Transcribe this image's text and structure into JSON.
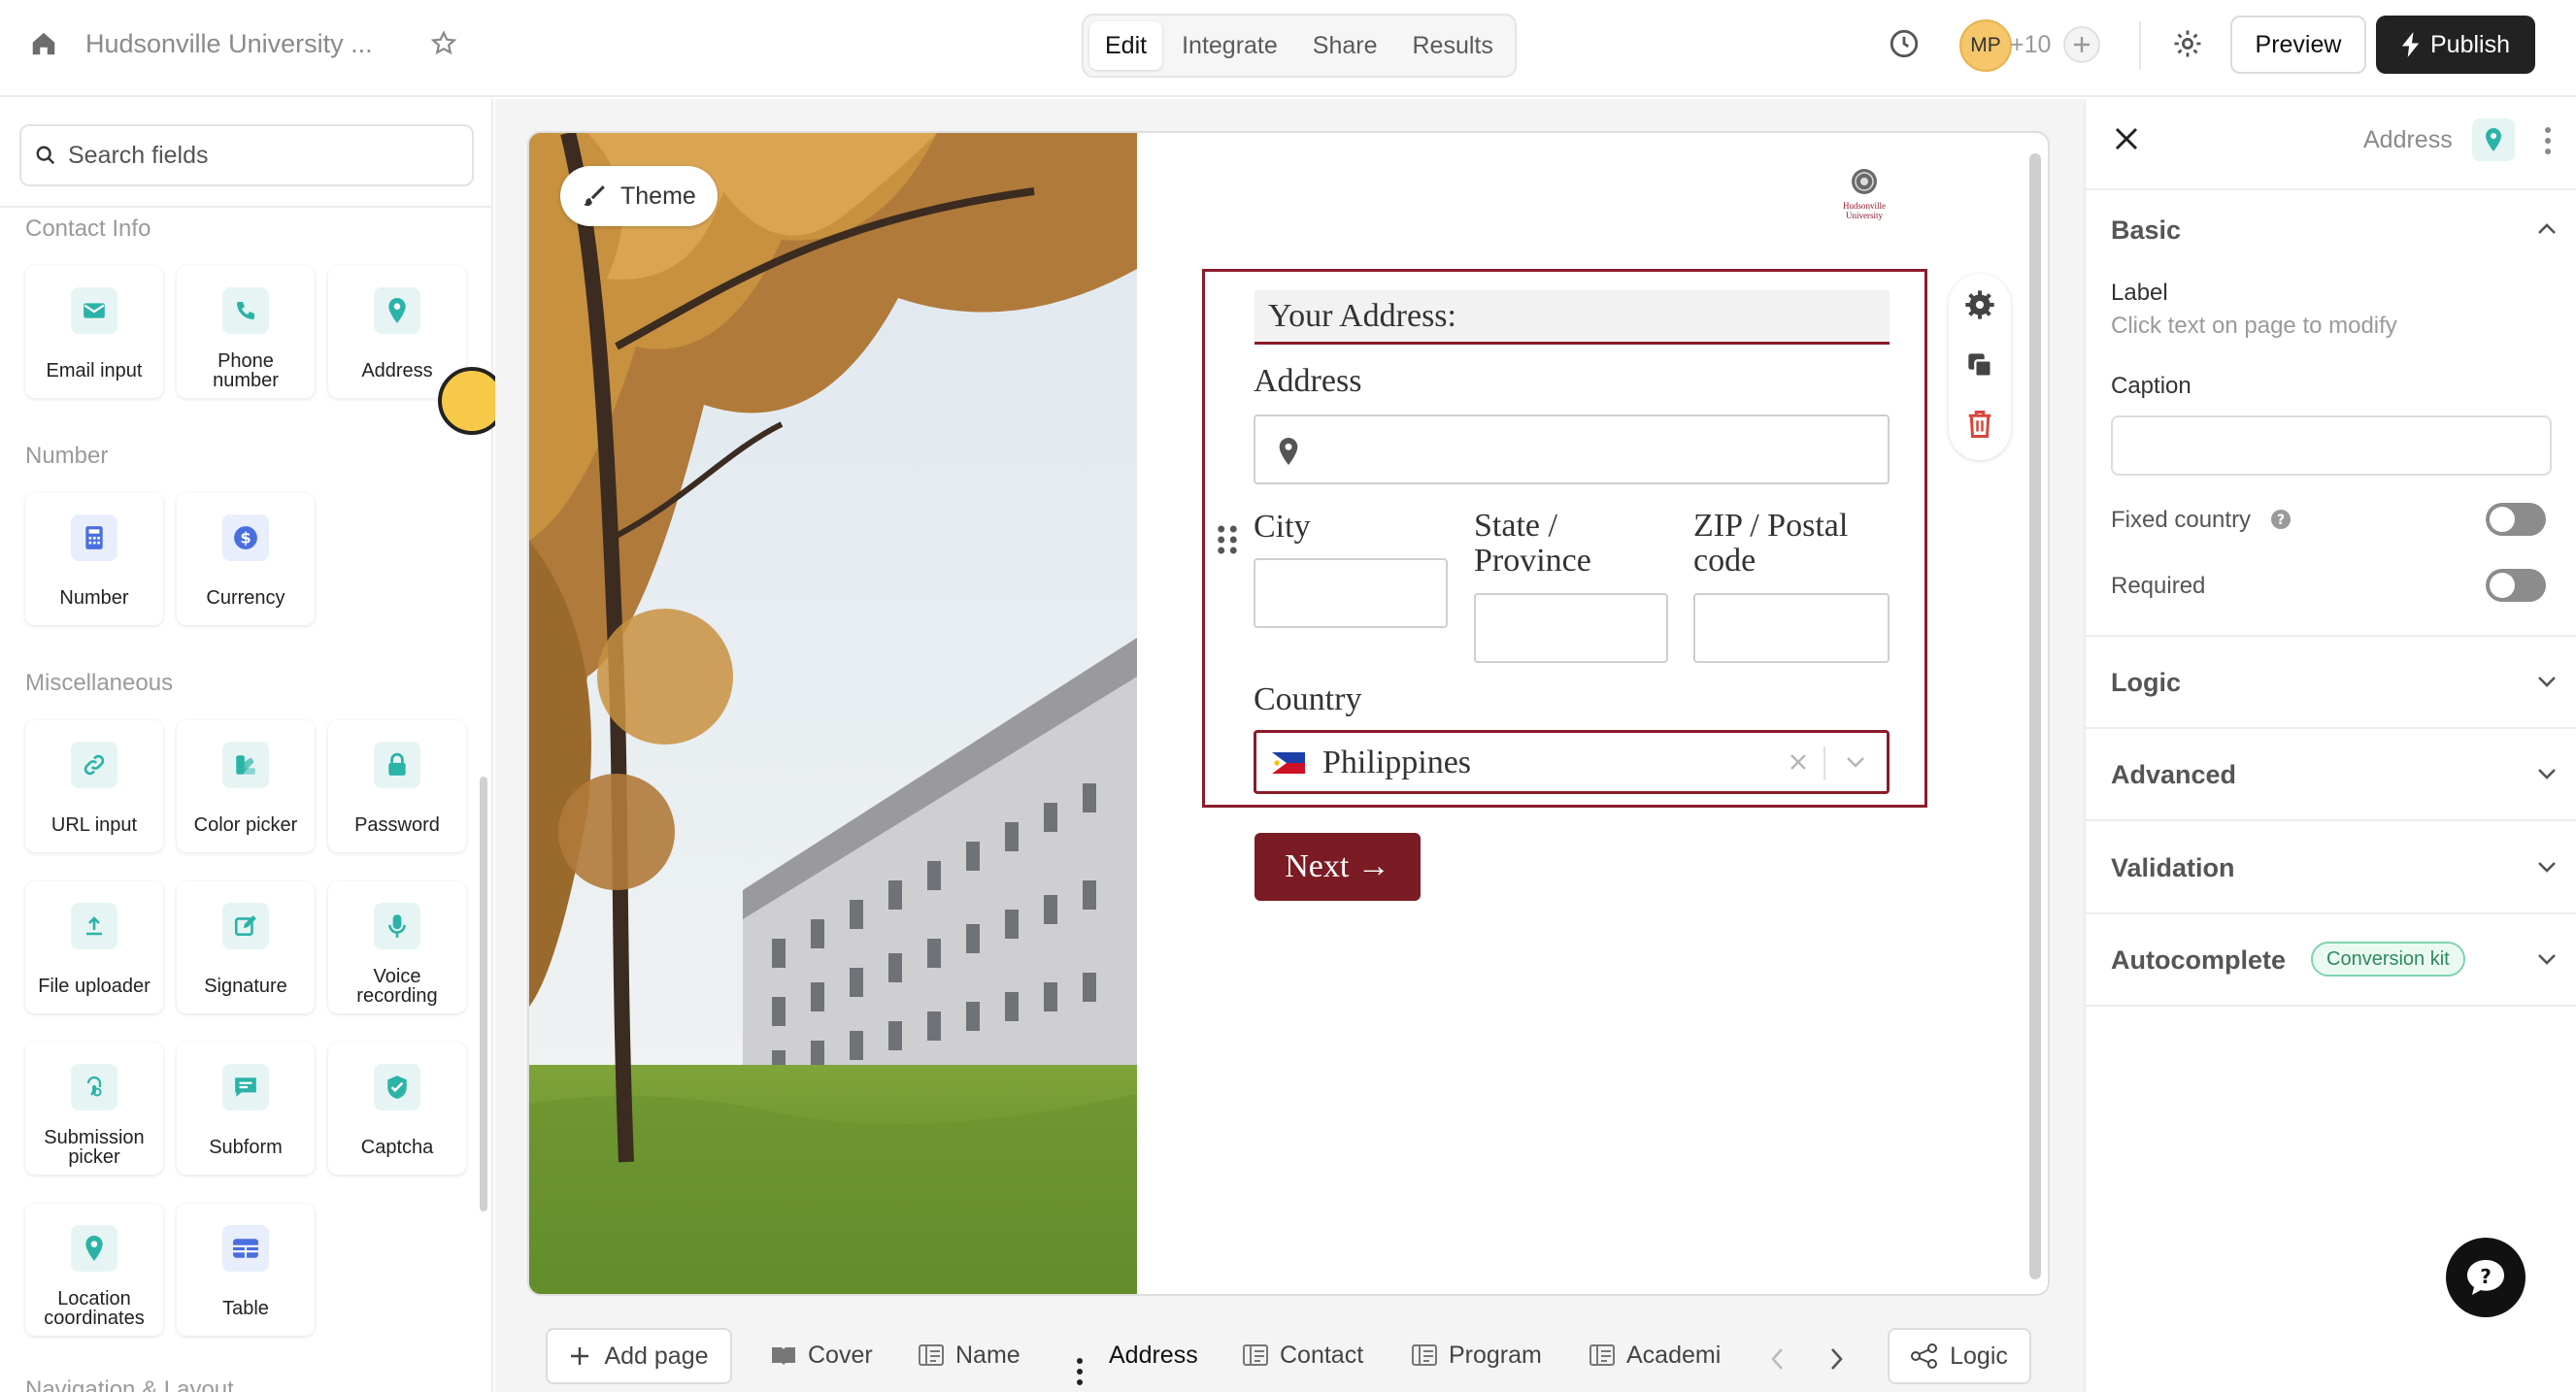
{
  "header": {
    "form_title": "Hudsonville University ...",
    "tabs": [
      {
        "label": "Edit"
      },
      {
        "label": "Integrate"
      },
      {
        "label": "Share"
      },
      {
        "label": "Results"
      }
    ],
    "avatar_initials": "MP",
    "collaborator_count": "+10",
    "preview_label": "Preview",
    "publish_label": "Publish"
  },
  "sidebar": {
    "search_placeholder": "Search fields",
    "sections": [
      {
        "title": "Contact Info",
        "items": [
          "Email input",
          "Phone number",
          "Address"
        ]
      },
      {
        "title": "Number",
        "items": [
          "Number",
          "Currency"
        ]
      },
      {
        "title": "Miscellaneous",
        "items": [
          "URL input",
          "Color picker",
          "Password",
          "File uploader",
          "Signature",
          "Voice recording",
          "Submission picker",
          "Subform",
          "Captcha",
          "Location coordinates",
          "Table"
        ]
      },
      {
        "title": "Navigation & Layout",
        "items": []
      }
    ]
  },
  "canvas": {
    "theme_label": "Theme",
    "logo_text_1": "Hudsonville",
    "logo_text_2": "University",
    "section_heading": "Your Address:",
    "address_label": "Address",
    "city_label": "City",
    "state_label_1": "State /",
    "state_label_2": "Province",
    "zip_label_1": "ZIP / Postal",
    "zip_label_2": "code",
    "country_label": "Country",
    "country_value": "Philippines",
    "next_label": "Next →"
  },
  "bottom_bar": {
    "add_page_label": "Add page",
    "pages": [
      {
        "label": "Cover"
      },
      {
        "label": "Name"
      },
      {
        "label": "Address"
      },
      {
        "label": "Contact"
      },
      {
        "label": "Program"
      },
      {
        "label": "Academi"
      }
    ],
    "logic_label": "Logic"
  },
  "right_panel": {
    "field_type": "Address",
    "basic_title": "Basic",
    "label_title": "Label",
    "label_hint": "Click text on page to modify",
    "caption_title": "Caption",
    "caption_value": "",
    "fixed_country_label": "Fixed country",
    "fixed_country_on": false,
    "required_label": "Required",
    "required_on": false,
    "sections": [
      {
        "title": "Logic"
      },
      {
        "title": "Advanced"
      },
      {
        "title": "Validation"
      },
      {
        "title": "Autocomplete"
      }
    ],
    "autocomplete_badge": "Conversion kit"
  },
  "colors": {
    "accent_maroon": "#8a1b2b",
    "next_button": "#7b1b23",
    "field_icon_teal": "#2bb3a8",
    "cursor_yellow": "#f7c948"
  }
}
